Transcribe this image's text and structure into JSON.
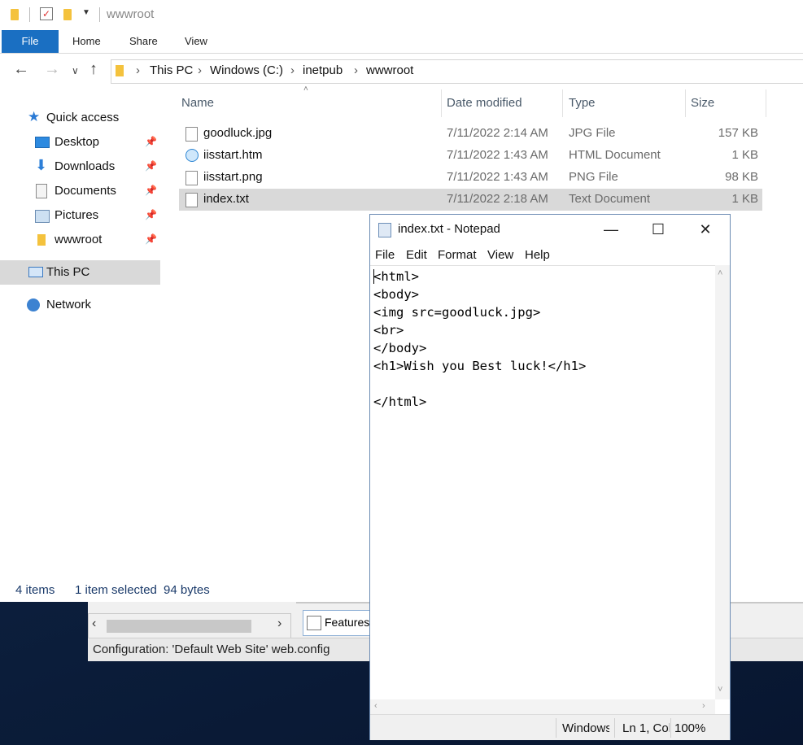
{
  "iis": {
    "features_label": "Features",
    "status_text": "Configuration: 'Default Web Site' web.config"
  },
  "explorer": {
    "title": "wwwroot",
    "ribbon_tabs": [
      "File",
      "Home",
      "Share",
      "View"
    ],
    "breadcrumb": [
      "This PC",
      "Windows (C:)",
      "inetpub",
      "wwwroot"
    ],
    "nav": {
      "quick_access": "Quick access",
      "items": [
        "Desktop",
        "Downloads",
        "Documents",
        "Pictures",
        "wwwroot"
      ],
      "this_pc": "This PC",
      "network": "Network"
    },
    "columns": {
      "name": "Name",
      "date": "Date modified",
      "type": "Type",
      "size": "Size"
    },
    "files": [
      {
        "name": "goodluck.jpg",
        "date": "7/11/2022 2:14 AM",
        "type": "JPG File",
        "size": "157 KB"
      },
      {
        "name": "iisstart.htm",
        "date": "7/11/2022 1:43 AM",
        "type": "HTML Document",
        "size": "1 KB"
      },
      {
        "name": "iisstart.png",
        "date": "7/11/2022 1:43 AM",
        "type": "PNG File",
        "size": "98 KB"
      },
      {
        "name": "index.txt",
        "date": "7/11/2022 2:18 AM",
        "type": "Text Document",
        "size": "1 KB"
      }
    ],
    "status": {
      "count": "4 items",
      "selected": "1 item selected",
      "bytes": "94 bytes"
    }
  },
  "notepad": {
    "title": "index.txt - Notepad",
    "menu": [
      "File",
      "Edit",
      "Format",
      "View",
      "Help"
    ],
    "content": "<html>\n<body>\n<img src=goodluck.jpg>\n<br>\n</body>\n<h1>Wish you Best luck!</h1>\n\n</html>",
    "status": {
      "encoding": "Windows",
      "position": "Ln 1, Col",
      "zoom": "100%"
    }
  }
}
